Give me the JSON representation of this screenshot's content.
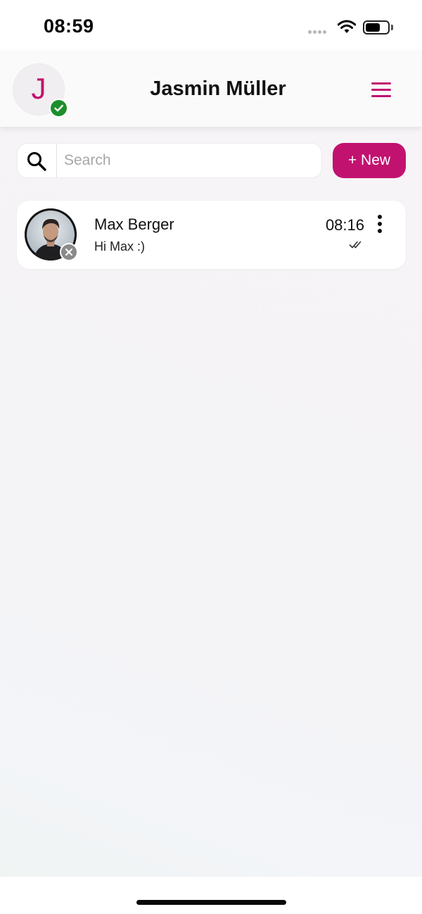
{
  "status_bar": {
    "time": "08:59",
    "icons": [
      "signal-dots-icon",
      "wifi-icon",
      "battery-icon"
    ],
    "battery_level": 0.65
  },
  "header": {
    "avatar_initial": "J",
    "title": "Jasmin Müller",
    "online_status": "online",
    "menu_icon": "hamburger-menu-icon"
  },
  "search": {
    "placeholder": "Search",
    "value": "",
    "icon": "search-icon"
  },
  "toolbar": {
    "new_label": "+ New"
  },
  "chats": [
    {
      "name": "Max Berger",
      "preview": "Hi Max :)",
      "time": "08:16",
      "status": "offline",
      "read_receipt": "double-check-icon"
    }
  ],
  "colors": {
    "accent": "#c2126f",
    "online": "#1e8e2a",
    "offline": "#8a8a8a"
  }
}
